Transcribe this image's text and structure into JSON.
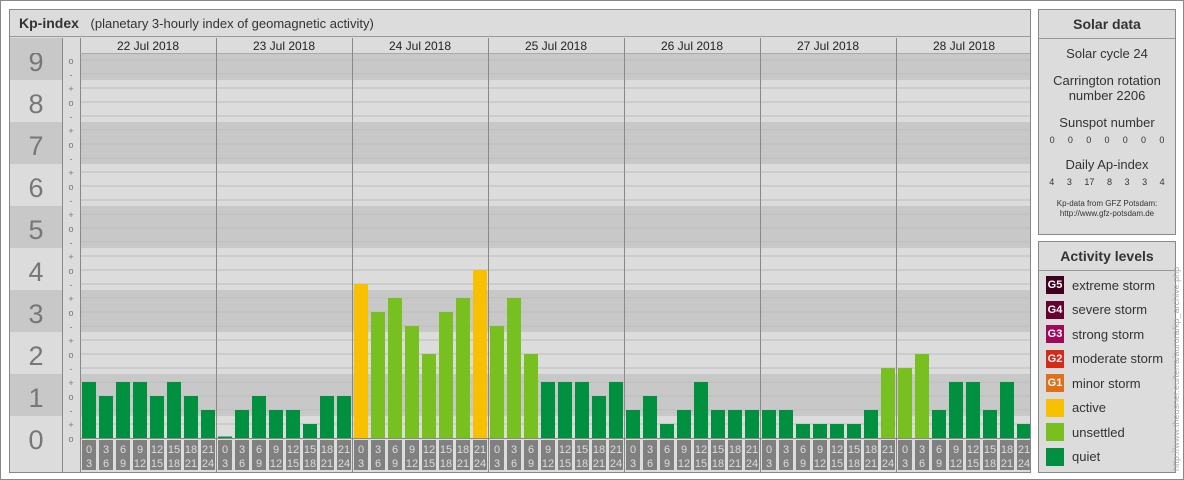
{
  "header": {
    "title": "Kp-index",
    "subtitle": "(planetary 3-hourly index of geomagnetic activity)"
  },
  "colors": {
    "quiet": "#009040",
    "unsettled": "#78c020",
    "active": "#f8c000",
    "G1": "#e07018",
    "G2": "#d82818",
    "G3": "#a00858",
    "G4": "#680030",
    "G5": "#400020"
  },
  "chart_data": {
    "type": "bar",
    "title": "Kp-index",
    "ylim": [
      0,
      9
    ],
    "y_ticks": [
      "0",
      "1",
      "2",
      "3",
      "4",
      "5",
      "6",
      "7",
      "8",
      "9"
    ],
    "sub_ticks": [
      "-",
      "o",
      "+"
    ],
    "days": [
      "22 Jul 2018",
      "23 Jul 2018",
      "24 Jul 2018",
      "25 Jul 2018",
      "26 Jul 2018",
      "27 Jul 2018",
      "28 Jul 2018"
    ],
    "intervals": [
      [
        "0",
        "3"
      ],
      [
        "3",
        "6"
      ],
      [
        "6",
        "9"
      ],
      [
        "9",
        "12"
      ],
      [
        "12",
        "15"
      ],
      [
        "15",
        "18"
      ],
      [
        "18",
        "21"
      ],
      [
        "21",
        "24"
      ]
    ],
    "kp": [
      [
        "1+",
        "1o",
        "1+",
        "1+",
        "1o",
        "1+",
        "1o",
        "1-"
      ],
      [
        "0o",
        "1-",
        "1o",
        "1-",
        "1-",
        "0+",
        "1o",
        "1o"
      ],
      [
        "4-",
        "3o",
        "3+",
        "3-",
        "2o",
        "3o",
        "3+",
        "4o"
      ],
      [
        "3-",
        "3+",
        "2o",
        "1+",
        "1+",
        "1+",
        "1o",
        "1+"
      ],
      [
        "1-",
        "1o",
        "0+",
        "1-",
        "1+",
        "1-",
        "1-",
        "1-"
      ],
      [
        "1-",
        "1-",
        "0+",
        "0+",
        "0+",
        "0+",
        "1-",
        "2-"
      ],
      [
        "2-",
        "2o",
        "1-",
        "1+",
        "1+",
        "1-",
        "1+",
        "0+"
      ]
    ]
  },
  "solar": {
    "title": "Solar data",
    "cycle": "Solar cycle 24",
    "carrington_1": "Carrington rotation",
    "carrington_2": "number 2206",
    "sunspot_label": "Sunspot number",
    "sunspots": [
      "0",
      "0",
      "0",
      "0",
      "0",
      "0",
      "0"
    ],
    "ap_label": "Daily Ap-index",
    "ap": [
      "4",
      "3",
      "17",
      "8",
      "3",
      "3",
      "4"
    ],
    "source_1": "Kp-data from GFZ Potsdam:",
    "source_2": "http://www.gfz-potsdam.de"
  },
  "levels": {
    "title": "Activity levels",
    "items": [
      {
        "badge": "G5",
        "label": "extreme storm",
        "key": "G5"
      },
      {
        "badge": "G4",
        "label": "severe storm",
        "key": "G4"
      },
      {
        "badge": "G3",
        "label": "strong storm",
        "key": "G3"
      },
      {
        "badge": "G2",
        "label": "moderate storm",
        "key": "G2"
      },
      {
        "badge": "G1",
        "label": "minor storm",
        "key": "G1"
      },
      {
        "badge": "",
        "label": "active",
        "key": "active"
      },
      {
        "badge": "",
        "label": "unsettled",
        "key": "unsettled"
      },
      {
        "badge": "",
        "label": "quiet",
        "key": "quiet"
      }
    ]
  },
  "watermark": "http://www.theusner.eu/terra/aurora/kp_archive.php"
}
